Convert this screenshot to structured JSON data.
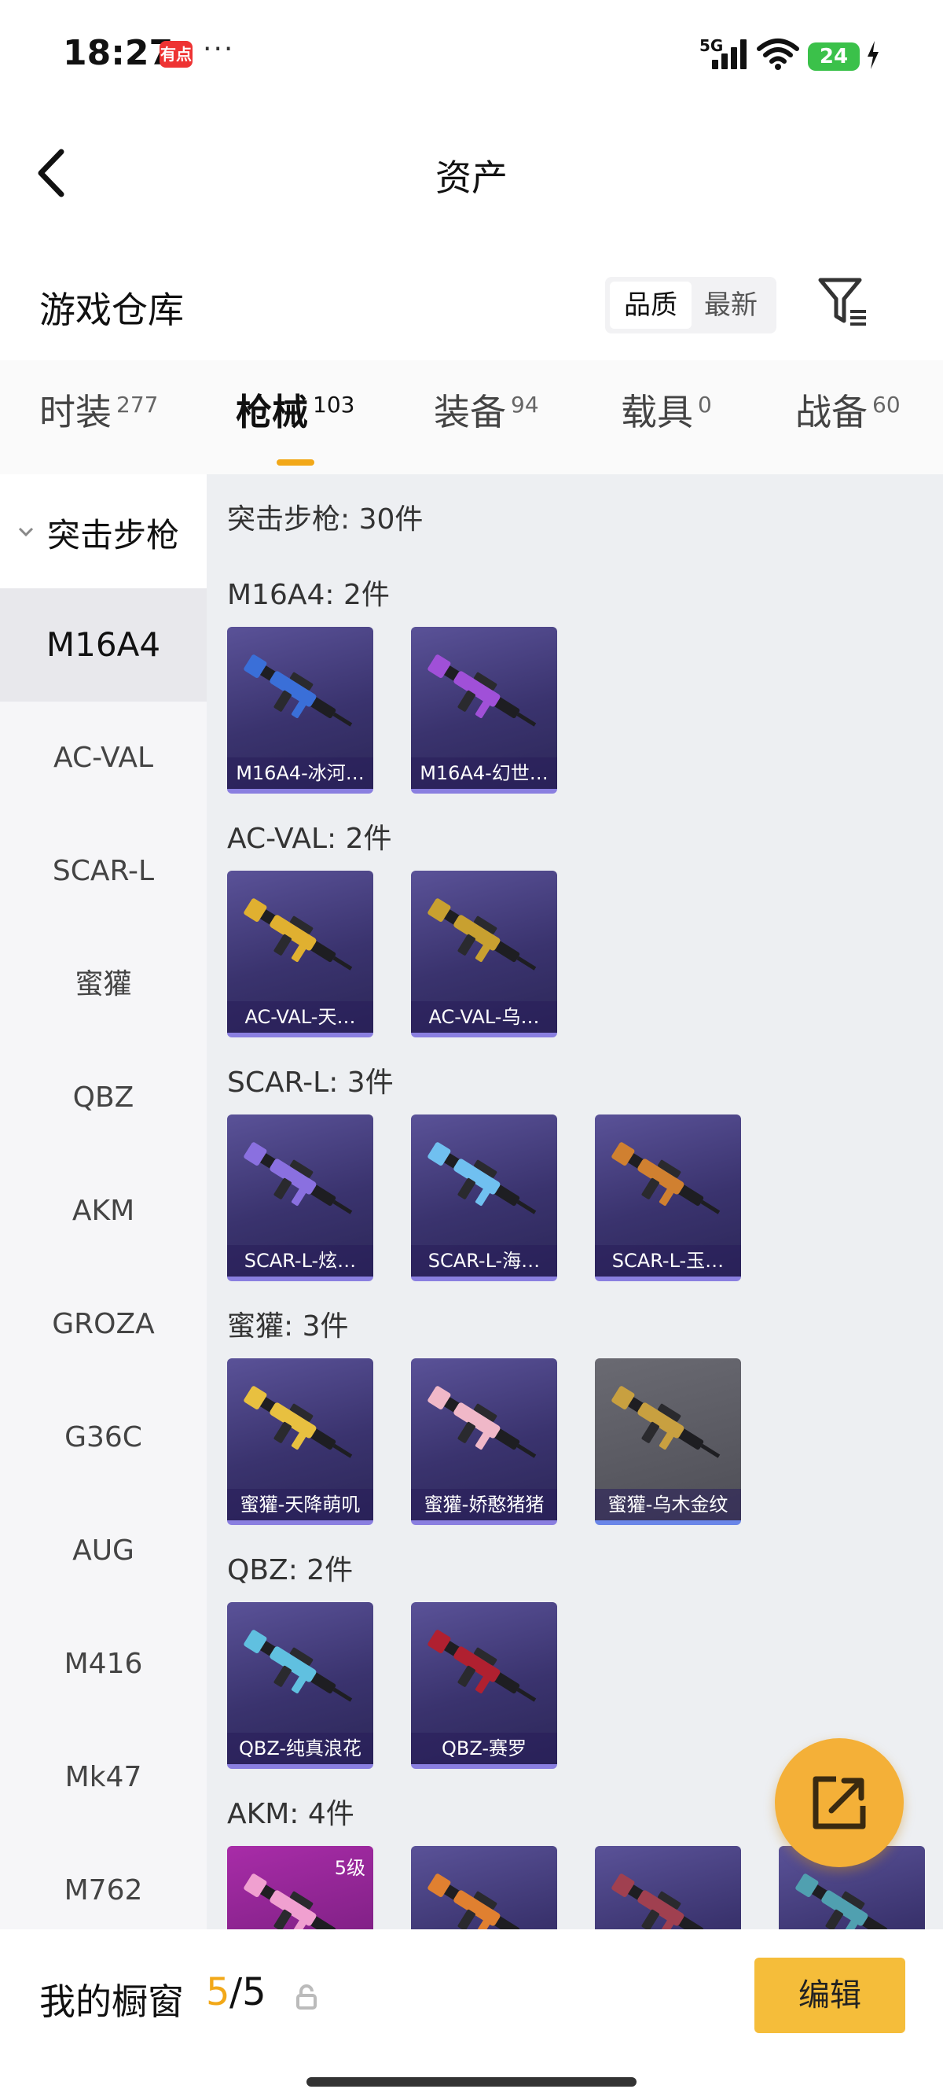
{
  "status_bar": {
    "time": "18:27",
    "app_icon_text": "有点",
    "more": "···",
    "network": "5G",
    "battery": "24"
  },
  "header": {
    "title": "资产"
  },
  "warehouse": {
    "label": "游戏仓库",
    "sort_options": [
      "品质",
      "最新"
    ],
    "active_sort": "品质"
  },
  "tabs": [
    {
      "label": "时装",
      "count": "277"
    },
    {
      "label": "枪械",
      "count": "103",
      "active": true
    },
    {
      "label": "装备",
      "count": "94"
    },
    {
      "label": "载具",
      "count": "0"
    },
    {
      "label": "战备",
      "count": "60"
    }
  ],
  "sidebar": {
    "category": "突击步枪",
    "items": [
      "M16A4",
      "AC-VAL",
      "SCAR-L",
      "蜜獾",
      "QBZ",
      "AKM",
      "GROZA",
      "G36C",
      "AUG",
      "M416",
      "Mk47",
      "M762"
    ],
    "active": "M16A4"
  },
  "content": {
    "summary": "突击步枪: 30件",
    "groups": [
      {
        "title": "M16A4: 2件",
        "items": [
          {
            "label": "M16A4-冰河…",
            "gun_color": "#3a6fd8"
          },
          {
            "label": "M16A4-幻世…",
            "gun_color": "#a050d8"
          }
        ]
      },
      {
        "title": "AC-VAL: 2件",
        "items": [
          {
            "label": "AC-VAL-天…",
            "gun_color": "#e0b030"
          },
          {
            "label": "AC-VAL-乌…",
            "gun_color": "#c8a030"
          }
        ]
      },
      {
        "title": "SCAR-L: 3件",
        "items": [
          {
            "label": "SCAR-L-炫…",
            "gun_color": "#8a70e0"
          },
          {
            "label": "SCAR-L-海…",
            "gun_color": "#70c0f0"
          },
          {
            "label": "SCAR-L-玉…",
            "gun_color": "#d08030"
          }
        ]
      },
      {
        "title": "蜜獾: 3件",
        "items": [
          {
            "label": "蜜獾-天降萌叽",
            "gun_color": "#e8c040"
          },
          {
            "label": "蜜獾-娇憨猪猪",
            "gun_color": "#f0b8c8"
          },
          {
            "label": "蜜獾-乌木金纹",
            "gun_color": "#c8a040",
            "gray": true
          }
        ]
      },
      {
        "title": "QBZ: 2件",
        "items": [
          {
            "label": "QBZ-纯真浪花",
            "gun_color": "#60c0e0"
          },
          {
            "label": "QBZ-赛罗",
            "gun_color": "#b02030"
          }
        ]
      },
      {
        "title": "AKM: 4件",
        "items": [
          {
            "label": "",
            "gun_color": "#f0a0d0",
            "pink": true,
            "level": "5级"
          },
          {
            "label": "",
            "gun_color": "#e08030"
          },
          {
            "label": "",
            "gun_color": "#a04050"
          },
          {
            "label": "",
            "gun_color": "#50a0b0"
          }
        ]
      }
    ]
  },
  "bottom": {
    "label": "我的橱窗",
    "current": "5",
    "total": "/5",
    "edit_label": "编辑"
  },
  "colors": {
    "accent": "#f2a818",
    "edit_button": "#f5bd3a",
    "card_bg": "#3a336e"
  }
}
